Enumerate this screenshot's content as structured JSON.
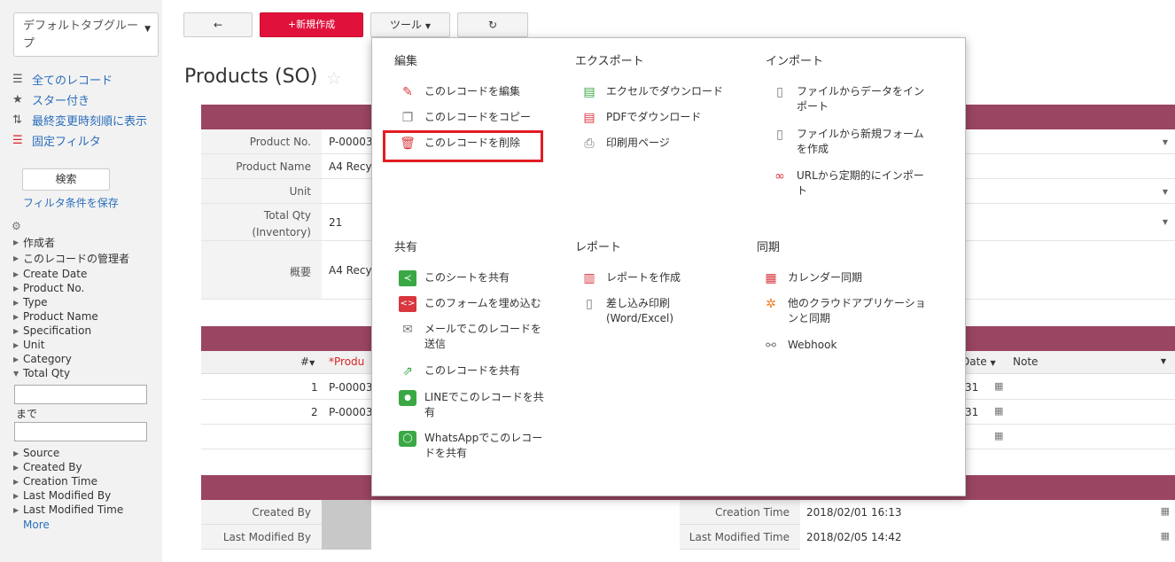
{
  "sidebar": {
    "group_select": "デフォルトタブグループ",
    "nav": [
      {
        "label": "全てのレコード",
        "icon": "list-icon"
      },
      {
        "label": "スター付き",
        "icon": "star-filter-icon"
      },
      {
        "label": "最終変更時刻順に表示",
        "icon": "sort-icon"
      },
      {
        "label": "固定フィルタ",
        "icon": "fixed-filter-icon"
      }
    ],
    "search_label": "検索",
    "save_filter_label": "フィルタ条件を保存",
    "filters": [
      "作成者",
      "このレコードの管理者",
      "Create Date",
      "Product No.",
      "Type",
      "Product Name",
      "Specification",
      "Unit",
      "Category",
      "Total Qty"
    ],
    "range_sep": "まで",
    "filters_after": [
      "Source",
      "Created By",
      "Creation Time",
      "Last Modified By",
      "Last Modified Time"
    ],
    "more_label": "More"
  },
  "toolbar": {
    "back_icon": "←",
    "new_label": "+新規作成",
    "tools_label": "ツール",
    "refresh_icon": "↻"
  },
  "page": {
    "title": "Products (SO)"
  },
  "record": {
    "fields": [
      {
        "label": "Product No.",
        "value": "P-00003"
      },
      {
        "label": "Product Name",
        "value": "A4 Recy"
      },
      {
        "label": "Unit",
        "value": ""
      },
      {
        "label": "Total Qty",
        "label2": "(Inventory)",
        "value": "21"
      },
      {
        "label": "概要",
        "value": "A4 Recy"
      }
    ]
  },
  "grid": {
    "col_num": "#",
    "col_product": "*Produ",
    "col_date": "Date",
    "col_note": "Note",
    "rows": [
      {
        "num": "1",
        "product": "P-00003",
        "date": "31"
      },
      {
        "num": "2",
        "product": "P-00003",
        "date": "31"
      }
    ]
  },
  "footer": {
    "created_by_label": "Created By",
    "last_modified_by_label": "Last Modified By",
    "creation_time_label": "Creation Time",
    "creation_time_value": "2018/02/01 16:13",
    "last_modified_time_label": "Last Modified Time",
    "last_modified_time_value": "2018/02/05 14:42"
  },
  "menu": {
    "sections": {
      "edit": "編集",
      "export": "エクスポート",
      "import": "インポート",
      "share": "共有",
      "report": "レポート",
      "sync": "同期"
    },
    "edit_items": [
      {
        "line1": "このレコードを編集",
        "icon": "pen-icon"
      },
      {
        "line1": "このレコードをコピー",
        "icon": "copy-icon"
      },
      {
        "line1": "このレコードを削除",
        "icon": "trash-icon"
      }
    ],
    "export_items": [
      {
        "line1": "エクセルでダウンロード",
        "icon": "excel-icon"
      },
      {
        "line1": "PDFでダウンロード",
        "icon": "pdf-icon"
      },
      {
        "line1": "印刷用ページ",
        "icon": "printer-icon"
      }
    ],
    "import_items": [
      {
        "line1": "ファイルからデータをイン",
        "line2": "ポート",
        "icon": "file-import-icon"
      },
      {
        "line1": "ファイルから新規フォーム",
        "line2": "を作成",
        "icon": "file-new-form-icon"
      },
      {
        "line1": "URLから定期的にインポー",
        "line2": "ト",
        "icon": "url-link-icon"
      }
    ],
    "share_items": [
      {
        "line1": "このシートを共有",
        "icon": "share-icon"
      },
      {
        "line1": "このフォームを埋め込む",
        "icon": "embed-icon"
      },
      {
        "line1": "メールでこのレコードを",
        "line2": "送信",
        "icon": "mail-icon"
      },
      {
        "line1": "このレコードを共有",
        "icon": "share-record-icon"
      },
      {
        "line1": "LINEでこのレコードを共",
        "line2": "有",
        "icon": "line-icon"
      },
      {
        "line1": "WhatsAppでこのレコー",
        "line2": "ドを共有",
        "icon": "whatsapp-icon"
      }
    ],
    "report_items": [
      {
        "line1": "レポートを作成",
        "icon": "bar-chart-icon"
      },
      {
        "line1": "差し込み印刷",
        "line2": "(Word/Excel)",
        "icon": "merge-print-icon"
      }
    ],
    "sync_items": [
      {
        "line1": "カレンダー同期",
        "icon": "calendar-icon"
      },
      {
        "line1": "他のクラウドアプリケーショ",
        "line2": "ンと同期",
        "icon": "cloud-sync-icon"
      },
      {
        "line1": "Webhook",
        "icon": "webhook-icon"
      }
    ]
  }
}
